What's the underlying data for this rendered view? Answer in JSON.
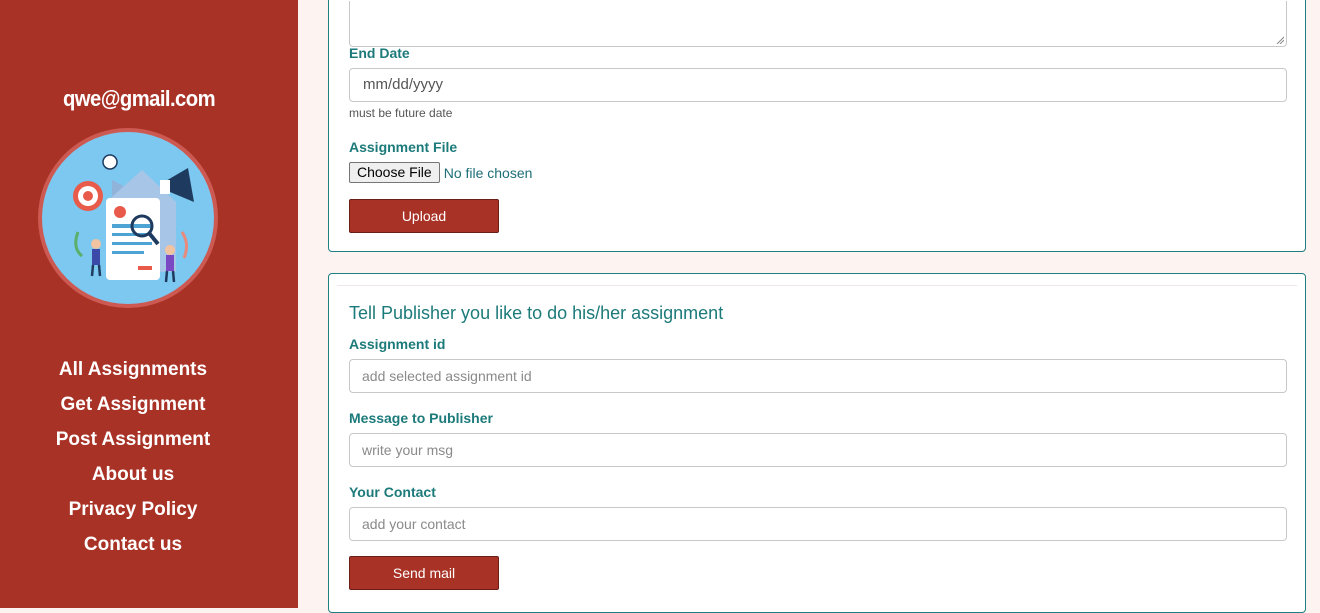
{
  "user": {
    "email": "qwe@gmail.com"
  },
  "sidebar": {
    "items": [
      {
        "label": "All Assignments"
      },
      {
        "label": "Get Assignment"
      },
      {
        "label": "Post Assignment"
      },
      {
        "label": "About us"
      },
      {
        "label": "Privacy Policy"
      },
      {
        "label": "Contact us"
      }
    ]
  },
  "post_form": {
    "end_date_label": "End Date",
    "end_date_value": "mm/dd/yyyy",
    "end_date_hint": "must be future date",
    "file_label": "Assignment File",
    "choose_file_label": "Choose File",
    "no_file_text": "No file chosen",
    "upload_label": "Upload"
  },
  "request_form": {
    "title": "Tell Publisher you like to do his/her assignment",
    "assignment_id_label": "Assignment id",
    "assignment_id_placeholder": "add selected assignment id",
    "message_label": "Message to Publisher",
    "message_placeholder": "write your msg",
    "contact_label": "Your Contact",
    "contact_placeholder": "add your contact",
    "send_label": "Send mail"
  },
  "colors": {
    "sidebar_bg": "#a93226",
    "accent_teal": "#1d7a7a",
    "page_bg": "#fdf3f1"
  }
}
